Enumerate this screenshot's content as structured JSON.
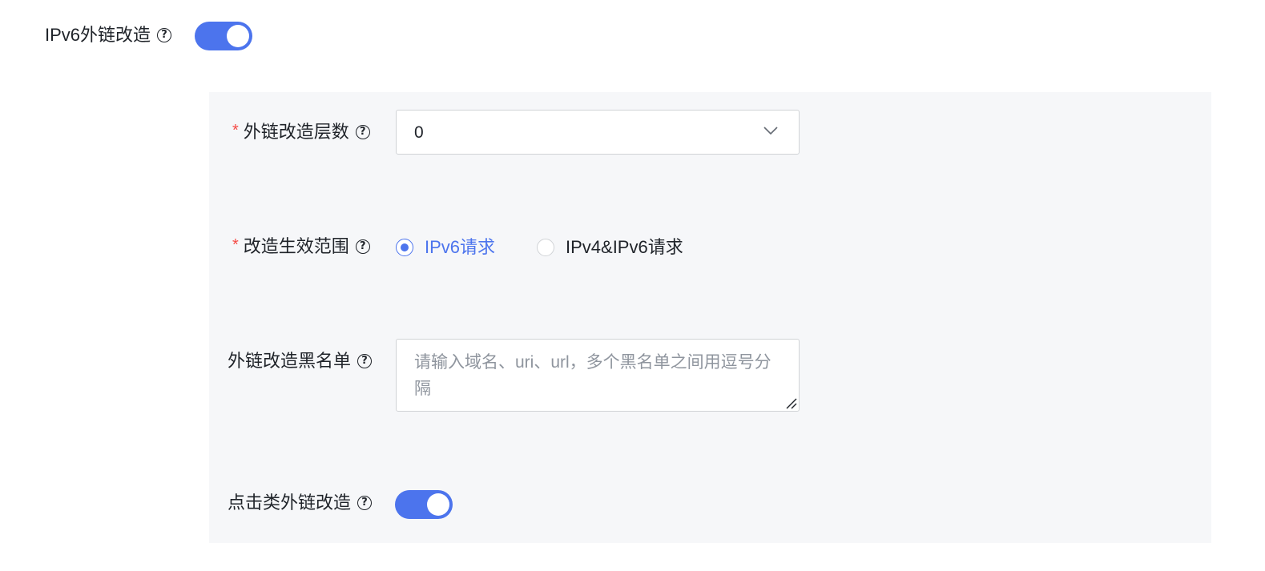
{
  "ipv6_link": {
    "label": "IPv6外链改造",
    "enabled": true
  },
  "rewrite_depth": {
    "required_mark": "*",
    "label": "外链改造层数",
    "value": "0"
  },
  "scope": {
    "required_mark": "*",
    "label": "改造生效范围",
    "options": [
      {
        "label": "IPv6请求",
        "checked": true
      },
      {
        "label": "IPv4&IPv6请求",
        "checked": false
      }
    ]
  },
  "blacklist": {
    "label": "外链改造黑名单",
    "placeholder": "请输入域名、uri、url，多个黑名单之间用逗号分隔"
  },
  "click_link": {
    "label": "点击类外链改造",
    "enabled": true
  },
  "colors": {
    "accent": "#4c74ed",
    "required": "#f54a45",
    "panel_bg": "#f6f7f9"
  },
  "icons": {
    "help": "question-circle-icon",
    "dropdown": "chevron-down-icon"
  }
}
